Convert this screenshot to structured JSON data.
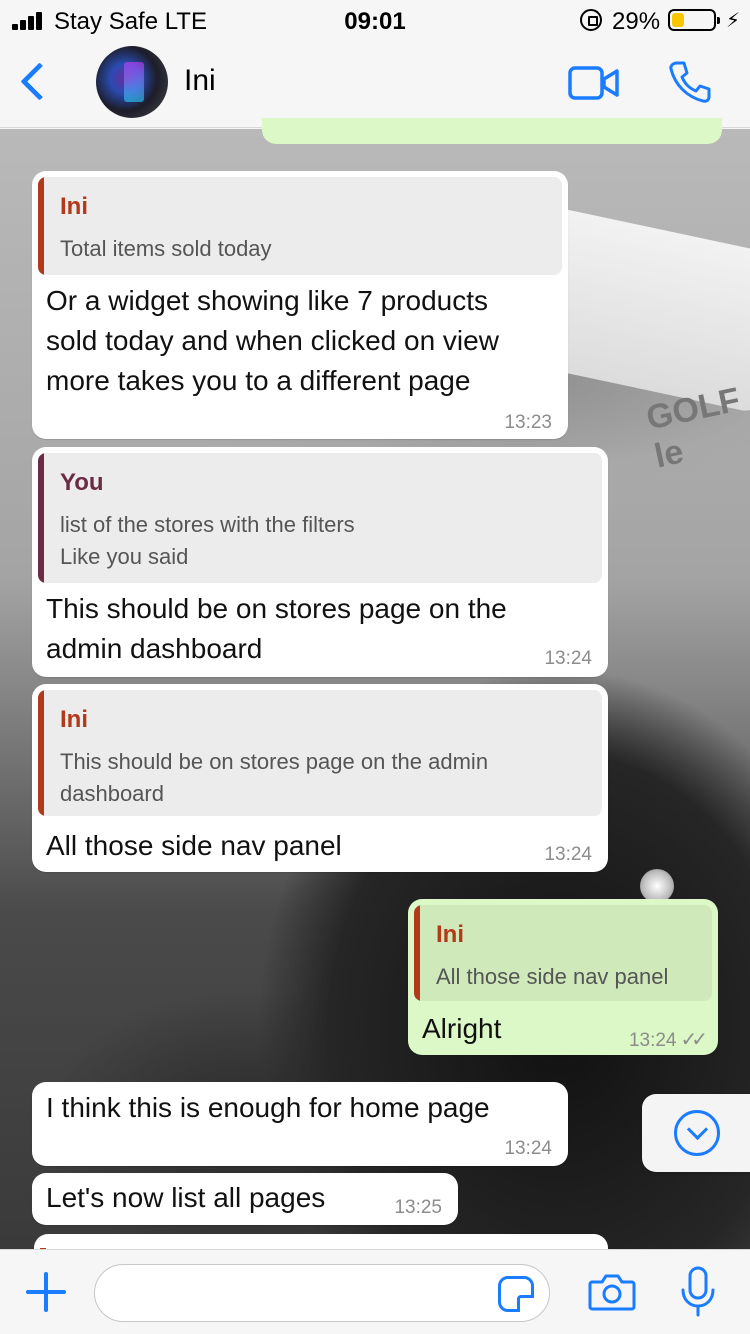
{
  "status_bar": {
    "carrier": "Stay Safe  LTE",
    "time": "09:01",
    "battery_percent": "29%",
    "battery_level": 0.29,
    "icons": [
      "signal-icon",
      "orientation-lock-icon",
      "battery-icon",
      "charging-icon"
    ]
  },
  "header": {
    "contact_name": "Ini",
    "icons": [
      "back-icon",
      "avatar",
      "video-call-icon",
      "voice-call-icon"
    ]
  },
  "messages": [
    {
      "direction": "incoming",
      "quote": {
        "author": "Ini",
        "text": "Total items sold today",
        "bar_color": "#b03a1a",
        "author_color": "#b03a1a"
      },
      "text_lines": [
        "Or a widget showing like 7 products",
        "sold today and when clicked on view",
        "more takes you to a different page"
      ],
      "time": "13:23"
    },
    {
      "direction": "incoming",
      "quote": {
        "author": "You",
        "text": "list of the stores with the filters\nLike you said",
        "bar_color": "#6b2b45",
        "author_color": "#6b2b45"
      },
      "text_lines": [
        "This should be on stores page on the",
        "admin dashboard"
      ],
      "time": "13:24"
    },
    {
      "direction": "incoming",
      "quote": {
        "author": "Ini",
        "text": "This should be on stores page on the admin\ndashboard",
        "bar_color": "#b03a1a",
        "author_color": "#b03a1a"
      },
      "text_lines": [
        "All those side nav panel"
      ],
      "time": "13:24"
    },
    {
      "direction": "outgoing",
      "quote": {
        "author": "Ini",
        "text": "All those side nav panel",
        "bar_color": "#b03a1a",
        "author_color": "#b03a1a"
      },
      "text_lines": [
        "Alright"
      ],
      "time": "13:24",
      "status": "read"
    },
    {
      "direction": "incoming",
      "text_lines": [
        "I think this is enough for home page"
      ],
      "time": "13:24"
    },
    {
      "direction": "incoming",
      "text_lines": [
        "Let's now list all pages"
      ],
      "time": "13:25"
    }
  ],
  "background": {
    "hat_text": "GOLF le"
  },
  "composer": {
    "input_value": "",
    "icons": [
      "plus-icon",
      "sticker-icon",
      "camera-icon",
      "microphone-icon"
    ]
  },
  "scroll_button": {
    "icon": "chevron-down-icon"
  },
  "colors": {
    "accent": "#1a7cff",
    "incoming_bubble": "#ffffff",
    "outgoing_bubble": "#dcf8c6",
    "battery_fill": "#f7c600"
  }
}
